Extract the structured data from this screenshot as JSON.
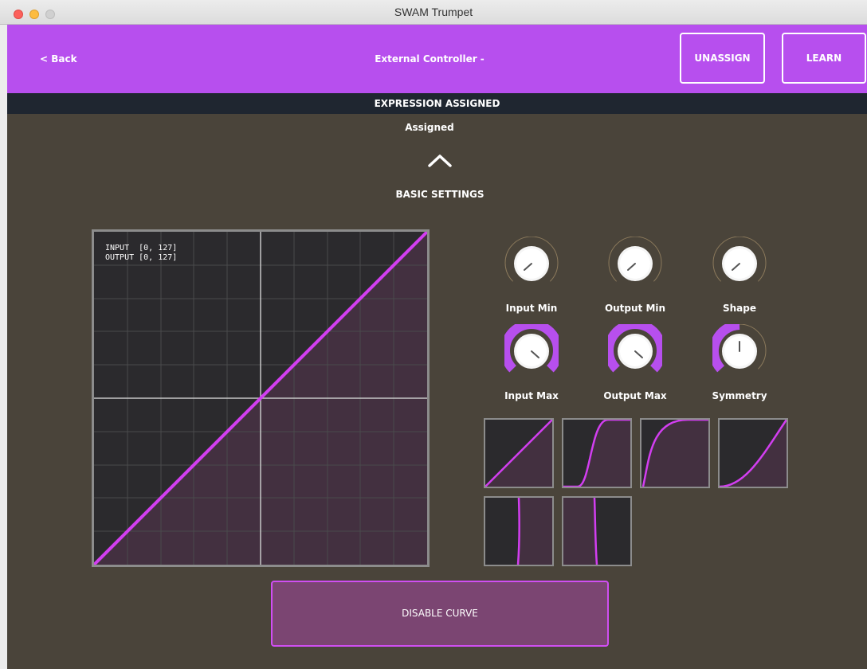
{
  "window": {
    "title": "SWAM Trumpet"
  },
  "header": {
    "back_label": "< Back",
    "title": "External Controller - Assigned",
    "unassign_label": "UNASSIGN",
    "learn_label": "LEARN"
  },
  "status": {
    "text": "EXPRESSION ASSIGNED"
  },
  "section": {
    "label": "BASIC SETTINGS"
  },
  "graph": {
    "input_text": "INPUT  [0, 127]",
    "output_text": "OUTPUT [0, 127]"
  },
  "knobs": [
    {
      "label": "Input Min",
      "value_fraction": 0.0
    },
    {
      "label": "Output Min",
      "value_fraction": 0.0
    },
    {
      "label": "Shape",
      "value_fraction": 0.0
    },
    {
      "label": "Input Max",
      "value_fraction": 1.0
    },
    {
      "label": "Output Max",
      "value_fraction": 1.0
    },
    {
      "label": "Symmetry",
      "value_fraction": 0.5
    }
  ],
  "curve_presets": [
    "linear",
    "s-curve",
    "fast-rise",
    "exponential",
    "vertical-step-left",
    "vertical-step-center"
  ],
  "disable_label": "DISABLE CURVE",
  "colors": {
    "accent": "#b74fee",
    "curve": "#d23ef0",
    "background": "#4a443a",
    "statusbar": "#1f2630"
  }
}
